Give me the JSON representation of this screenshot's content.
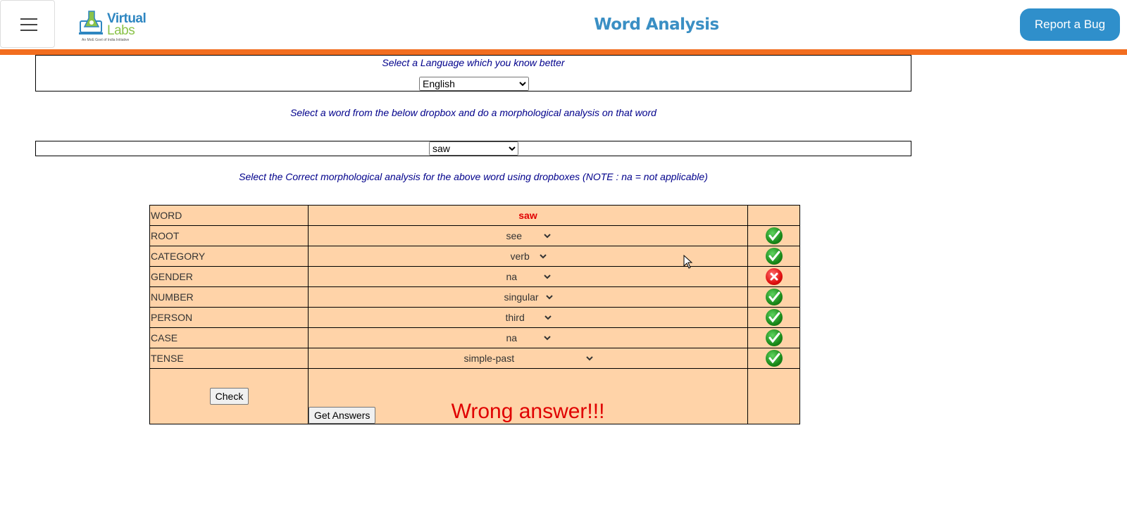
{
  "header": {
    "logo_line1": "Virtual",
    "logo_line2": "Labs",
    "logo_tagline": "An MoE Govt of India Initiative",
    "title": "Word Analysis",
    "report_bug": "Report a Bug"
  },
  "language": {
    "instruction": "Select a Language which you know better",
    "selected": "English"
  },
  "word_select": {
    "instruction": "Select a word from the below dropbox and do a morphological analysis on that word",
    "selected": "saw"
  },
  "analysis": {
    "instruction": "Select the Correct morphological analysis for the above word using dropboxes (NOTE : na = not applicable)",
    "word_label": "WORD",
    "word_value": "saw",
    "rows": [
      {
        "label": "ROOT",
        "value": "see",
        "status": "correct"
      },
      {
        "label": "CATEGORY",
        "value": "verb",
        "status": "correct"
      },
      {
        "label": "GENDER",
        "value": "na",
        "status": "wrong"
      },
      {
        "label": "NUMBER",
        "value": "singular",
        "status": "correct"
      },
      {
        "label": "PERSON",
        "value": "third",
        "status": "correct"
      },
      {
        "label": "CASE",
        "value": "na",
        "status": "correct"
      },
      {
        "label": "TENSE",
        "value": "simple-past",
        "status": "correct"
      }
    ],
    "check_label": "Check",
    "result_text": "Wrong answer!!!",
    "get_answers_label": "Get Answers"
  },
  "colors": {
    "accent_blue": "#2f8fcb",
    "orange_bar": "#f26d1f",
    "table_bg": "#ffd3a8",
    "error_red": "#e00000"
  }
}
